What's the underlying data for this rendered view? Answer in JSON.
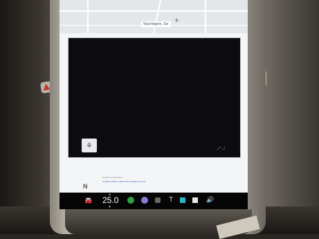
{
  "map": {
    "label": "Washington, Ste",
    "pin_icon": "pin-icon"
  },
  "video": {
    "thumbnail_icon": "logo-icon",
    "thumbnail_glyph": "⚘"
  },
  "media": {
    "line1": "Nearest energy panel",
    "line2": "Coupling 100% in effect now at Batteries found",
    "source_icon": "N"
  },
  "taskbar": {
    "temperature": "25.0",
    "icons": [
      "car-icon",
      "phone-icon",
      "music-icon",
      "camera-icon",
      "tesla-icon",
      "app-icon",
      "calendar-icon",
      "volume-icon"
    ]
  }
}
